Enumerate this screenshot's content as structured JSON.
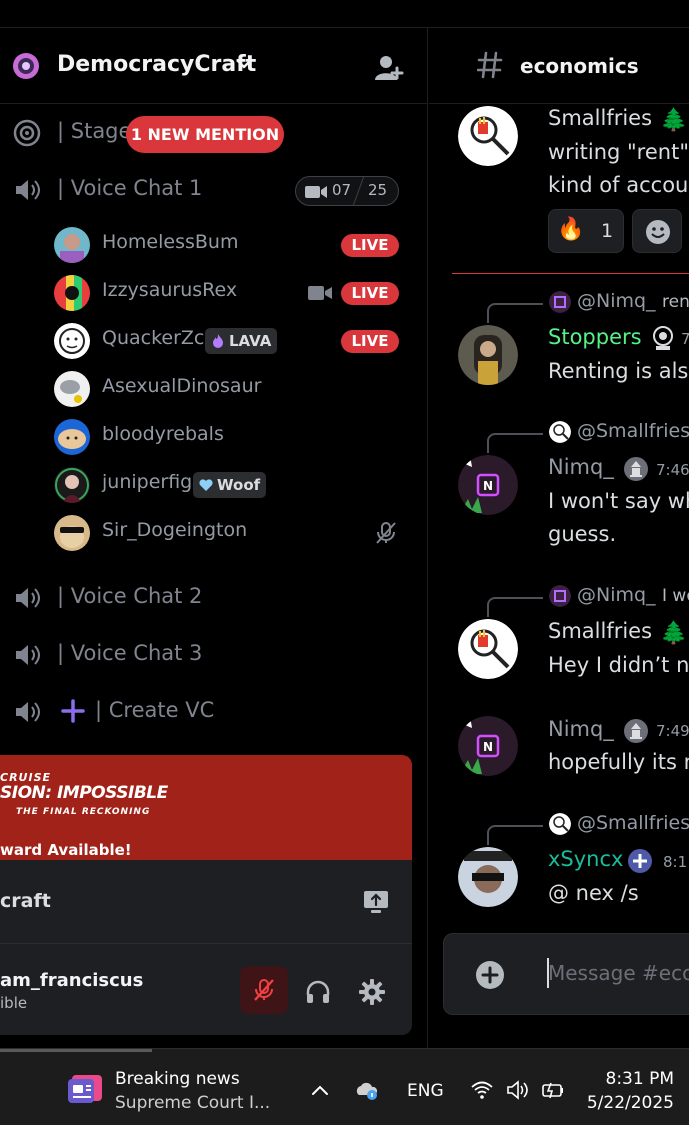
{
  "server": {
    "name": "DemocracyCraft"
  },
  "channels": {
    "stage": "| Stage",
    "mention_pill": "1 NEW MENTION",
    "vc1": "| Voice Chat 1",
    "vc1_video": "07",
    "vc1_limit": "25",
    "vc2": "| Voice Chat 2",
    "vc3": "| Voice Chat 3",
    "create": "| Create VC"
  },
  "members": [
    {
      "name": "HomelessBum",
      "live": "LIVE"
    },
    {
      "name": "IzzysaurusRex",
      "live": "LIVE"
    },
    {
      "name": "QuackerZc",
      "tag": "LAVA",
      "live": "LIVE"
    },
    {
      "name": "AsexualDinosaur"
    },
    {
      "name": "bloodyrebals"
    },
    {
      "name": "juniperfig",
      "tag": "Woof"
    },
    {
      "name": "Sir_Dogeington"
    }
  ],
  "promo": {
    "line1": "CRUISE",
    "line2": "SION: IMPOSSIBLE",
    "line3": "THE FINAL RECKONING",
    "line4": "ward Available!"
  },
  "voice_panel": {
    "name": "craft"
  },
  "user_panel": {
    "name": "am_franciscus",
    "status": "ible"
  },
  "chat": {
    "channel": "economics",
    "messages": [
      {
        "author": "Smallfries",
        "author_color": "#b5bac1",
        "lines": [
          "writing \"rent\"",
          "kind of accoun"
        ],
        "reaction_count": "1"
      },
      {
        "reply_to": "@Nimq_",
        "reply_text": "ren",
        "author": "Stoppers",
        "author_color": "#57f287",
        "time": "7",
        "lines": [
          "Renting is also"
        ]
      },
      {
        "reply_to": "@Smallfries",
        "author": "Nimq_",
        "author_color": "#949ba4",
        "time": "7:46",
        "lines": [
          "I won't say whe",
          "guess."
        ]
      },
      {
        "reply_to": "@Nimq_",
        "reply_text": "I wo",
        "author": "Smallfries",
        "author_color": "#b5bac1",
        "lines": [
          "Hey I didn’t na"
        ]
      },
      {
        "author": "Nimq_",
        "author_color": "#949ba4",
        "time": "7:49",
        "lines": [
          "hopefully its n"
        ]
      },
      {
        "reply_to": "@Smallfries",
        "author": "xSyncx",
        "author_color": "#1abc9c",
        "time": "8:1",
        "lines": [
          "@ nex /s"
        ]
      }
    ],
    "composer_placeholder": "Message #eco"
  },
  "taskbar": {
    "news_title": "Breaking news",
    "news_sub": "Supreme Court I...",
    "lang": "ENG",
    "time": "8:31 PM",
    "date": "5/22/2025"
  }
}
